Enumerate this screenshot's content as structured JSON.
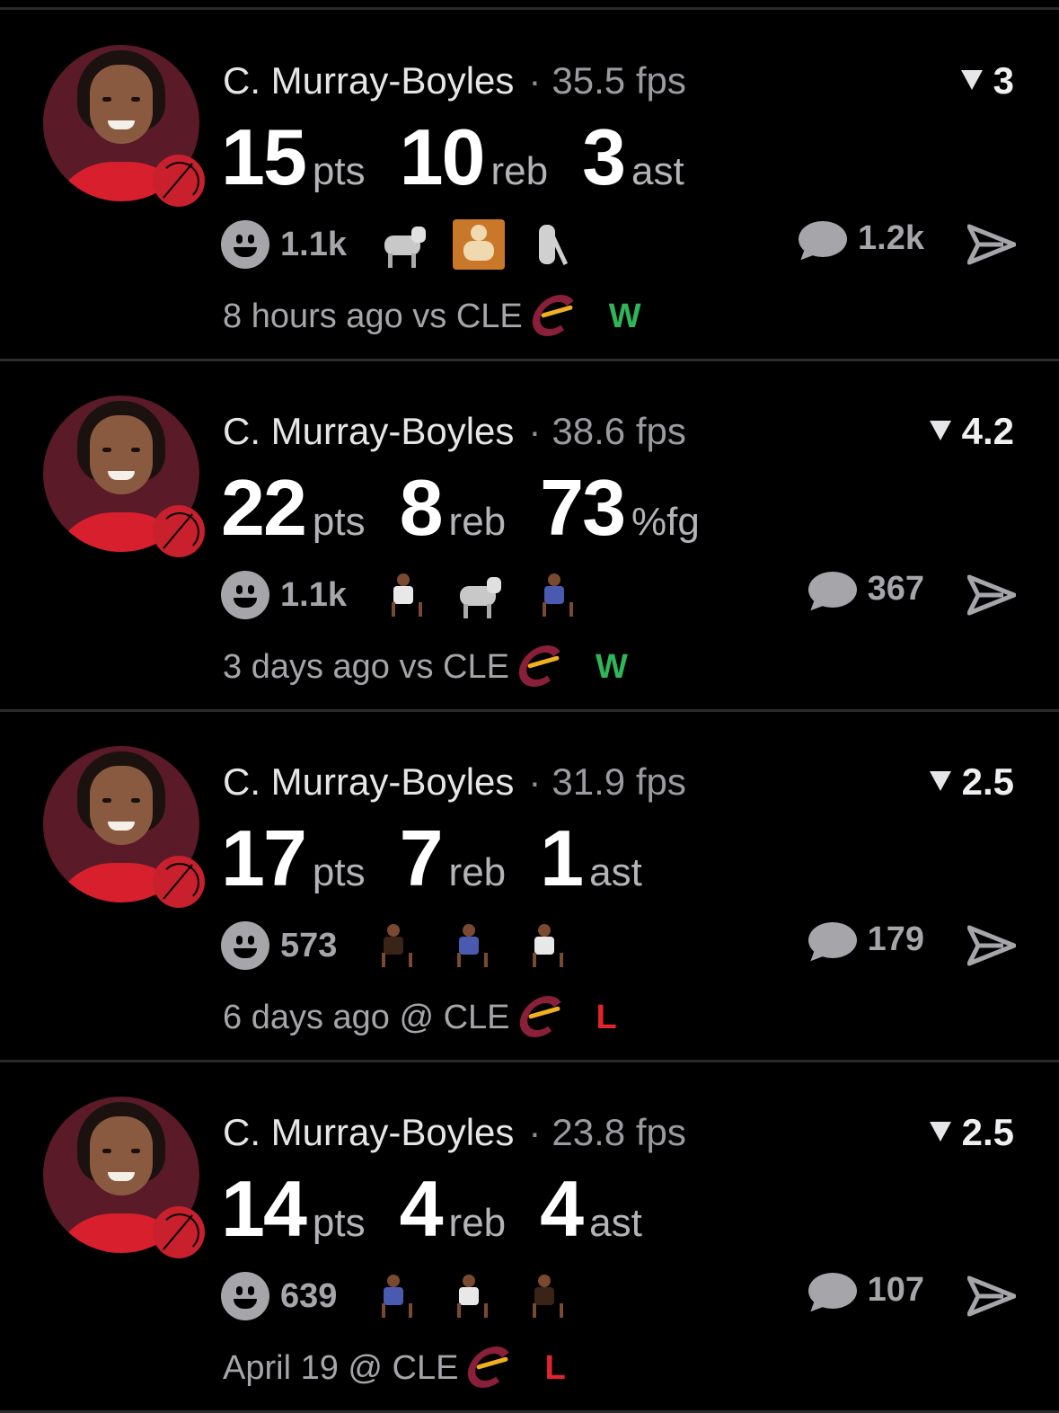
{
  "cards": [
    {
      "name": "C. Murray-Boyles",
      "sep": "·",
      "fps": "35.5 fps",
      "metric": "3",
      "stats": [
        {
          "num": "15",
          "unit": "pts"
        },
        {
          "num": "10",
          "unit": "reb"
        },
        {
          "num": "3",
          "unit": "ast"
        }
      ],
      "reaction_count": "1.1k",
      "emojis": [
        "goat-emoji",
        "baby-emoji",
        "cane-emoji"
      ],
      "comment_count": "1.2k",
      "footer": "8 hours ago vs CLE",
      "result": "W"
    },
    {
      "name": "C. Murray-Boyles",
      "sep": "·",
      "fps": "38.6 fps",
      "metric": "4.2",
      "stats": [
        {
          "num": "22",
          "unit": "pts"
        },
        {
          "num": "8",
          "unit": "reb"
        },
        {
          "num": "73",
          "unit": "%fg"
        }
      ],
      "reaction_count": "1.1k",
      "emojis": [
        "player-emoji",
        "goat-emoji",
        "player-emoji"
      ],
      "comment_count": "367",
      "footer": "3 days ago vs CLE",
      "result": "W"
    },
    {
      "name": "C. Murray-Boyles",
      "sep": "·",
      "fps": "31.9 fps",
      "metric": "2.5",
      "stats": [
        {
          "num": "17",
          "unit": "pts"
        },
        {
          "num": "7",
          "unit": "reb"
        },
        {
          "num": "1",
          "unit": "ast"
        }
      ],
      "reaction_count": "573",
      "emojis": [
        "player-emoji",
        "player-emoji",
        "player-emoji"
      ],
      "comment_count": "179",
      "footer": "6 days ago @ CLE",
      "result": "L"
    },
    {
      "name": "C. Murray-Boyles",
      "sep": "·",
      "fps": "23.8 fps",
      "metric": "2.5",
      "stats": [
        {
          "num": "14",
          "unit": "pts"
        },
        {
          "num": "4",
          "unit": "reb"
        },
        {
          "num": "4",
          "unit": "ast"
        }
      ],
      "reaction_count": "639",
      "emojis": [
        "player-emoji",
        "player-emoji",
        "player-emoji"
      ],
      "comment_count": "107",
      "footer": "April 19 @ CLE",
      "result": "L"
    }
  ],
  "colors": {
    "background": "#000000",
    "win": "#2fb55a",
    "loss": "#e0242b",
    "muted": "#a5a5aa",
    "team_primary": "#d81f2d"
  }
}
